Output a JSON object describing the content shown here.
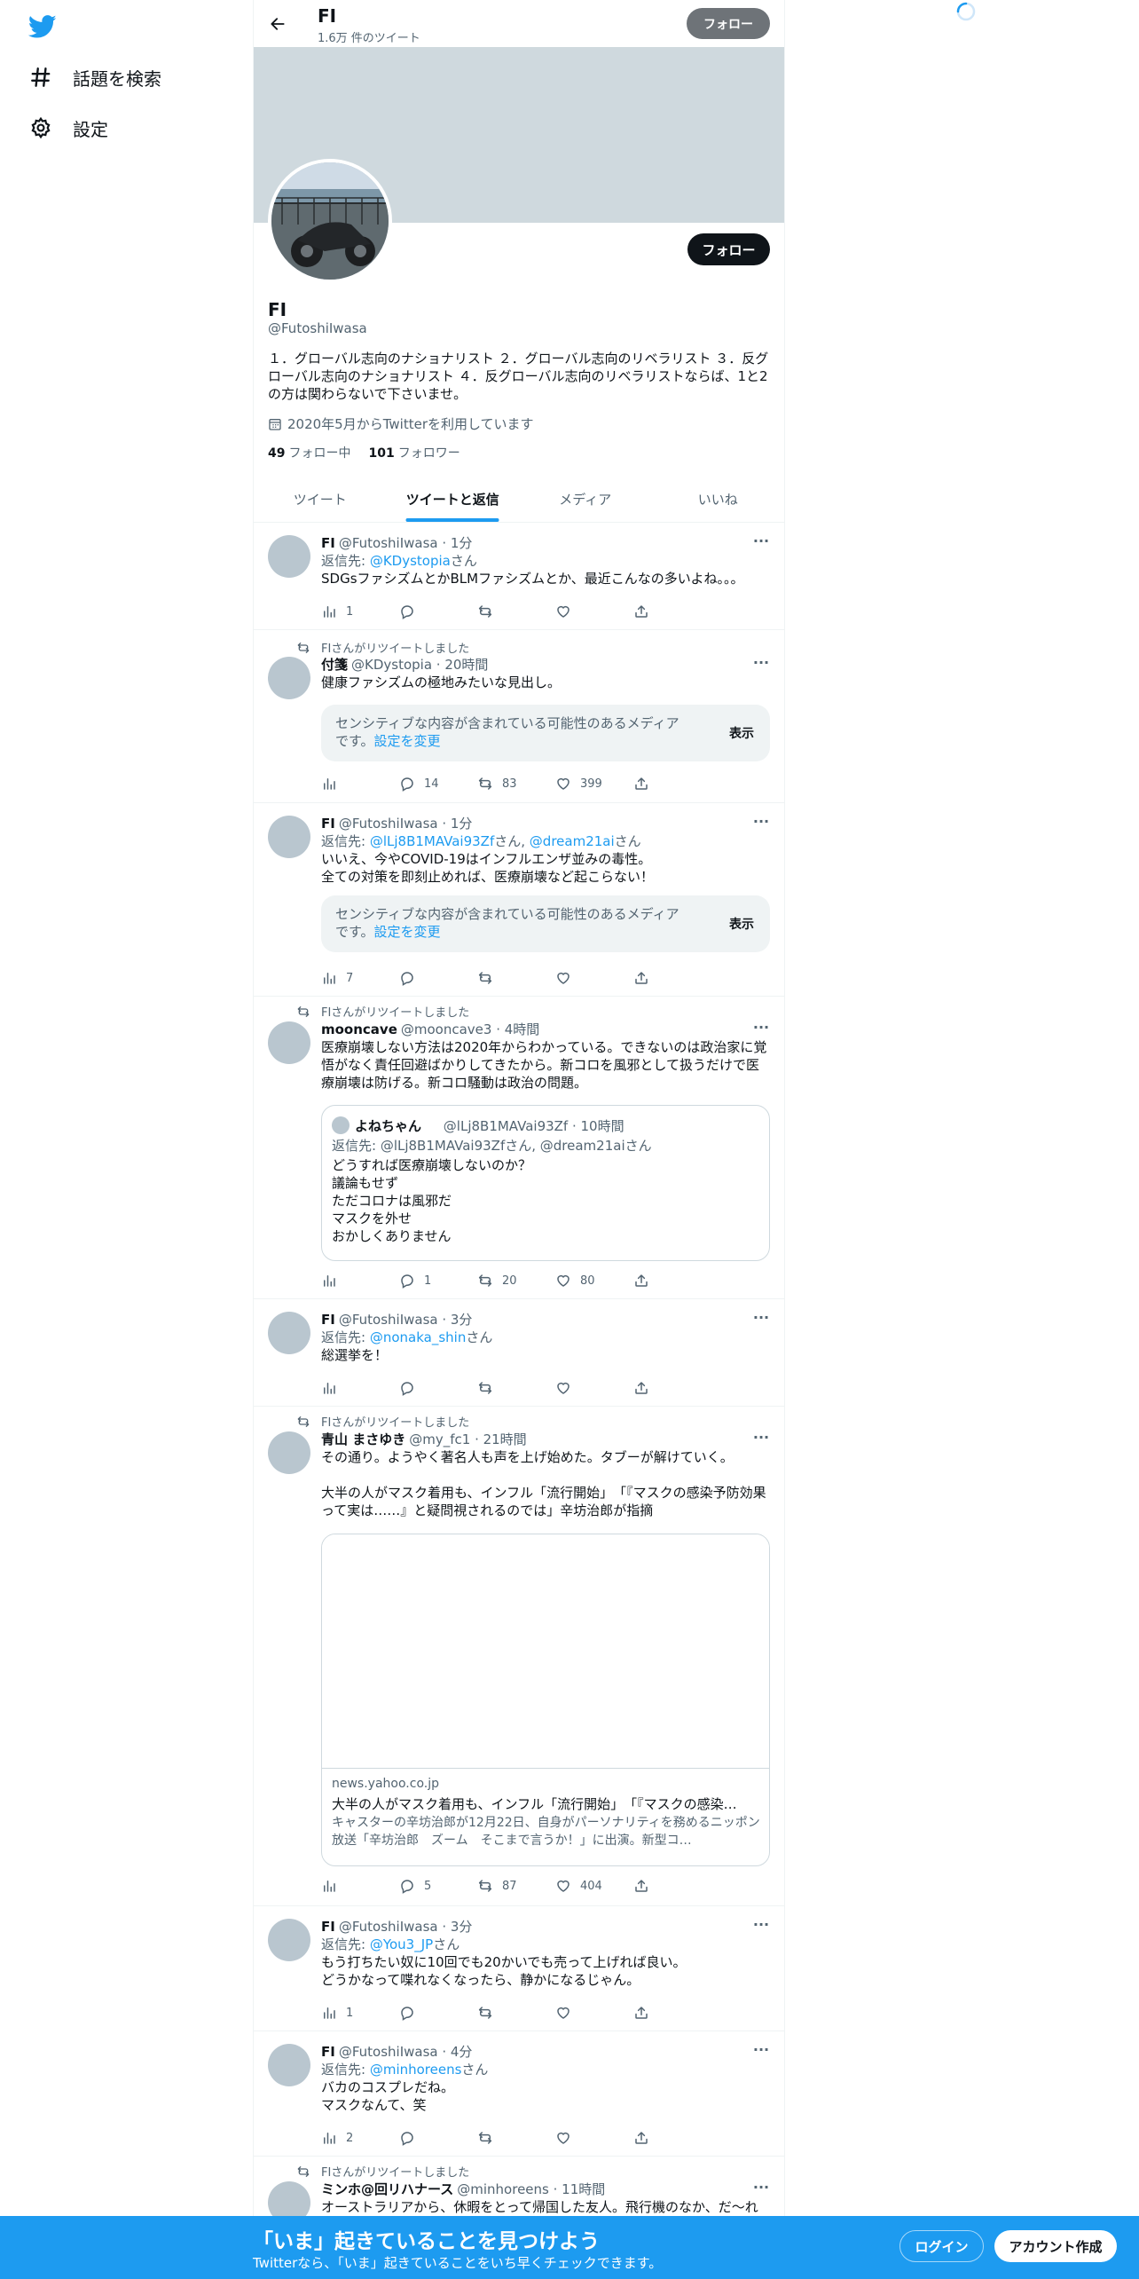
{
  "sidebar": {
    "items": [
      {
        "label": "話題を検索",
        "icon": "hashtag-icon"
      },
      {
        "label": "設定",
        "icon": "gear-icon"
      }
    ]
  },
  "header": {
    "name": "FI",
    "tweet_count": "1.6万 件のツイート",
    "follow_label": "フォロー"
  },
  "profile": {
    "name": "FI",
    "handle": "@FutoshiIwasa",
    "bio": "１．グローバル志向のナショナリスト ２．グローバル志向のリベラリスト ３．反グローバル志向のナショナリスト ４．反グローバル志向のリベラリストならば、1と2の方は関わらないで下さいませ。",
    "joined": "2020年5月からTwitterを利用しています",
    "following_count": "49",
    "following_label": "フォロー中",
    "followers_count": "101",
    "followers_label": "フォロワー",
    "follow_label": "フォロー"
  },
  "tabs": [
    {
      "label": "ツイート",
      "active": false
    },
    {
      "label": "ツイートと返信",
      "active": true
    },
    {
      "label": "メディア",
      "active": false
    },
    {
      "label": "いいね",
      "active": false
    }
  ],
  "sensitive": {
    "text": "センシティブな内容が含まれている可能性のあるメディアです。",
    "link": "設定を変更",
    "show": "表示"
  },
  "tweets": [
    {
      "name": "FI",
      "meta": "@FutoshiIwasa · 1分",
      "reply_prefix": "返信先: ",
      "reply_to": "@KDystopia",
      "reply_suffix": "さん",
      "text": "SDGsファシズムとかBLMファシズムとか、最近こんなの多いよね。。。",
      "views": "1",
      "replies": "",
      "retweets": "",
      "likes": ""
    },
    {
      "retweeted_by": "FIさんがリツイートしました",
      "name": "付箋",
      "meta": "@KDystopia · 20時間",
      "text": "健康ファシズムの極地みたいな見出し。",
      "views": "",
      "replies": "14",
      "retweets": "83",
      "likes": "399"
    },
    {
      "name": "FI",
      "meta": "@FutoshiIwasa · 1分",
      "reply_prefix": "返信先: ",
      "reply_to": "@lLj8B1MAVai93Zf",
      "reply_mid": "さん, ",
      "reply_to2": "@dream21ai",
      "reply_suffix": "さん",
      "text": "いいえ、今やCOVID-19はインフルエンザ並みの毒性。\n全ての対策を即刻止めれば、医療崩壊など起こらない！",
      "views": "7",
      "replies": "",
      "retweets": "",
      "likes": ""
    },
    {
      "retweeted_by": "FIさんがリツイートしました",
      "name": "mooncave",
      "meta": "@mooncave3 · 4時間",
      "text": "医療崩壊しない方法は2020年からわかっている。できないのは政治家に覚悟がなく責任回避ばかりしてきたから。新コロを風邪として扱うだけで医療崩壊は防げる。新コロ騒動は政治の問題。",
      "quote": {
        "name": "よねちゃん",
        "meta": "@lLj8B1MAVai93Zf · 10時間",
        "reply": "返信先: @lLj8B1MAVai93Zfさん, @dream21aiさん",
        "text": "どうすれば医療崩壊しないのか？\n議論もせず\nただコロナは風邪だ\nマスクを外せ\nおかしくありません"
      },
      "views": "",
      "replies": "1",
      "retweets": "20",
      "likes": "80"
    },
    {
      "name": "FI",
      "meta": "@FutoshiIwasa · 3分",
      "reply_prefix": "返信先: ",
      "reply_to": "@nonaka_shin",
      "reply_suffix": "さん",
      "text": "総選挙を！",
      "views": "",
      "replies": "",
      "retweets": "",
      "likes": ""
    },
    {
      "retweeted_by": "FIさんがリツイートしました",
      "name": "青山 まさゆき",
      "meta": "@my_fc1 · 21時間",
      "text": "その通り。ようやく著名人も声を上げ始めた。タブーが解けていく。\n\n大半の人がマスク着用も、インフル「流行開始」　「『マスクの感染予防効果って実は……』と疑問視されるのでは」辛坊治郎が指摘",
      "card": {
        "domain": "news.yahoo.co.jp",
        "title": "大半の人がマスク着用も、インフル「流行開始」　「『マスクの感染…",
        "desc": "キャスターの辛坊治郎が12月22日、自身がパーソナリティを務めるニッポン放送「辛坊治郎　ズーム　そこまで言うか！」に出演。新型コ…"
      },
      "views": "",
      "replies": "5",
      "retweets": "87",
      "likes": "404"
    },
    {
      "name": "FI",
      "meta": "@FutoshiIwasa · 3分",
      "reply_prefix": "返信先: ",
      "reply_to": "@You3_JP",
      "reply_suffix": "さん",
      "text": "もう打ちたい奴に10回でも20かいでも売って上げれば良い。\nどうかなって喋れなくなったら、静かになるじゃん。",
      "views": "1",
      "replies": "",
      "retweets": "",
      "likes": ""
    },
    {
      "name": "FI",
      "meta": "@FutoshiIwasa · 4分",
      "reply_prefix": "返信先: ",
      "reply_to": "@minhoreens",
      "reply_suffix": "さん",
      "text": "バカのコスプレだね。\nマスクなんて、笑",
      "views": "2",
      "replies": "",
      "retweets": "",
      "likes": ""
    },
    {
      "retweeted_by": "FIさんがリツイートしました",
      "name": "ミンホ@回リハナース",
      "meta": "@minhoreens · 11時間",
      "text": "オーストラリアから、休暇をとって帰国した友人。飛行機のなか、だ〜れ"
    }
  ],
  "bottom": {
    "title": "「いま」起きていることを見つけよう",
    "subtitle": "Twitterなら、「いま」起きていることをいち早くチェックできます。",
    "login": "ログイン",
    "signup": "アカウント作成"
  },
  "colors": {
    "accent": "#1d9bf0",
    "text": "#0f1419",
    "muted": "#536471",
    "banner": "#cfd9de"
  }
}
